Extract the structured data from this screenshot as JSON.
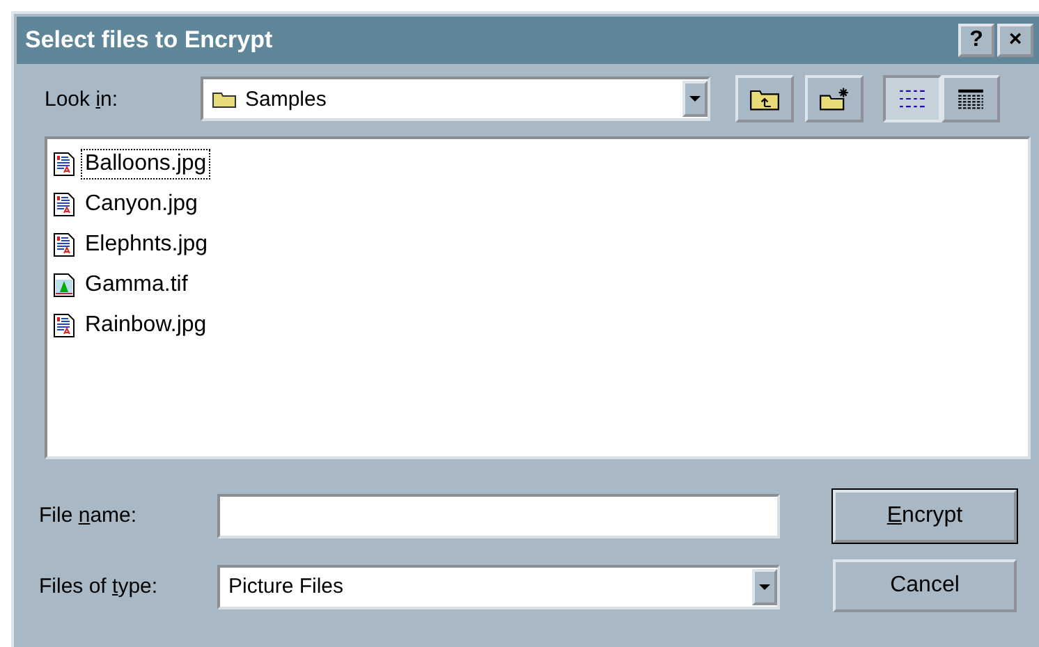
{
  "window": {
    "title": "Select files to Encrypt",
    "title_buttons": [
      "?",
      "×"
    ]
  },
  "look_in": {
    "label_parts": [
      {
        "text": "Look ",
        "underline": false
      },
      {
        "text": "i",
        "underline": true
      },
      {
        "text": "n:",
        "underline": false
      }
    ],
    "value": "Samples"
  },
  "view_buttons": [
    {
      "kind": "list",
      "selected": true
    },
    {
      "kind": "details",
      "selected": false
    }
  ],
  "files": [
    {
      "name": "Balloons.jpg",
      "kind": "jpg",
      "selected": true
    },
    {
      "name": "Canyon.jpg",
      "kind": "jpg",
      "selected": false
    },
    {
      "name": "Elephnts.jpg",
      "kind": "jpg",
      "selected": false
    },
    {
      "name": "Gamma.tif",
      "kind": "tif",
      "selected": false
    },
    {
      "name": "Rainbow.jpg",
      "kind": "jpg",
      "selected": false
    }
  ],
  "file_name": {
    "label_parts": [
      {
        "text": "File ",
        "underline": false
      },
      {
        "text": "n",
        "underline": true
      },
      {
        "text": "ame:",
        "underline": false
      }
    ]
  },
  "file_type": {
    "label_parts": [
      {
        "text": "Files of ",
        "underline": false
      },
      {
        "text": "t",
        "underline": true
      },
      {
        "text": "ype:",
        "underline": false
      }
    ],
    "value": "Picture Files"
  },
  "buttons": [
    {
      "label_parts": [
        {
          "text": "E",
          "underline": true
        },
        {
          "text": "ncrypt",
          "underline": false
        }
      ],
      "default": true
    },
    {
      "label_parts": [
        {
          "text": "Cancel",
          "underline": false
        }
      ],
      "default": false
    }
  ]
}
